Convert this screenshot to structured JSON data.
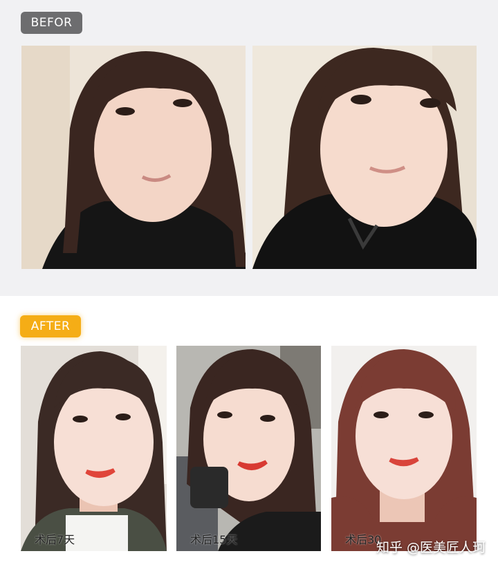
{
  "before": {
    "badge": "BEFOR"
  },
  "after": {
    "badge": "AFTER",
    "captions": [
      "术后7天",
      "术后15天",
      "术后30"
    ]
  },
  "watermark": "知乎 @医美匠人珂",
  "colors": {
    "before_badge": "#6d6d6f",
    "after_badge": "#f5ad16",
    "before_bg": "#f1f1f3"
  }
}
